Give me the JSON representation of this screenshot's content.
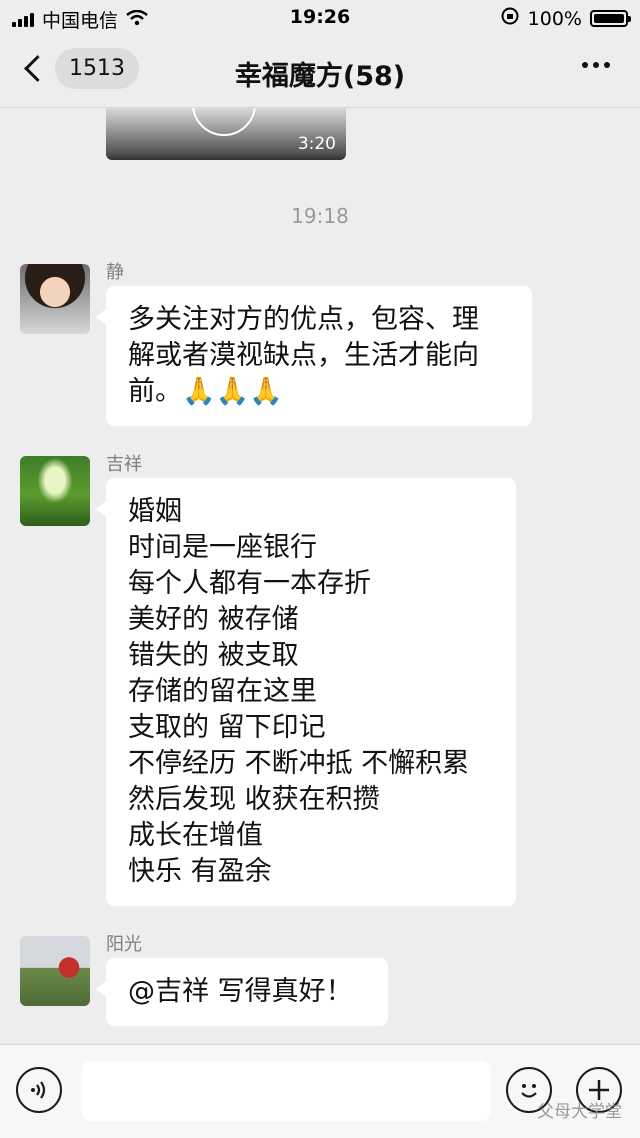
{
  "status_bar": {
    "carrier": "中国电信",
    "time": "19:26",
    "battery": "100%"
  },
  "nav": {
    "unread_count": "1513",
    "title": "幸福魔方(58)"
  },
  "video": {
    "duration": "3:20"
  },
  "timestamp": "19:18",
  "messages": [
    {
      "sender": "静",
      "lines": [
        "多关注对方的优点，包容、理",
        "解或者漠视缺点，生活才能向",
        "前。🙏🙏🙏"
      ]
    },
    {
      "sender": "吉祥",
      "lines": [
        "婚姻",
        "时间是一座银行",
        "每个人都有一本存折",
        "美好的 被存储",
        "错失的 被支取",
        "存储的留在这里",
        "支取的 留下印记",
        "不停经历 不断冲抵 不懈积累",
        "然后发现 收获在积攒",
        "成长在增值",
        "快乐 有盈余"
      ]
    },
    {
      "sender": "阳光",
      "lines": [
        "@吉祥 写得真好！"
      ]
    }
  ],
  "watermark": "父母大学堂",
  "icons": {
    "back": "chevron-left-icon",
    "more": "more-dots-icon",
    "voice": "voice-icon",
    "emoji": "emoji-icon",
    "plus": "plus-icon"
  }
}
